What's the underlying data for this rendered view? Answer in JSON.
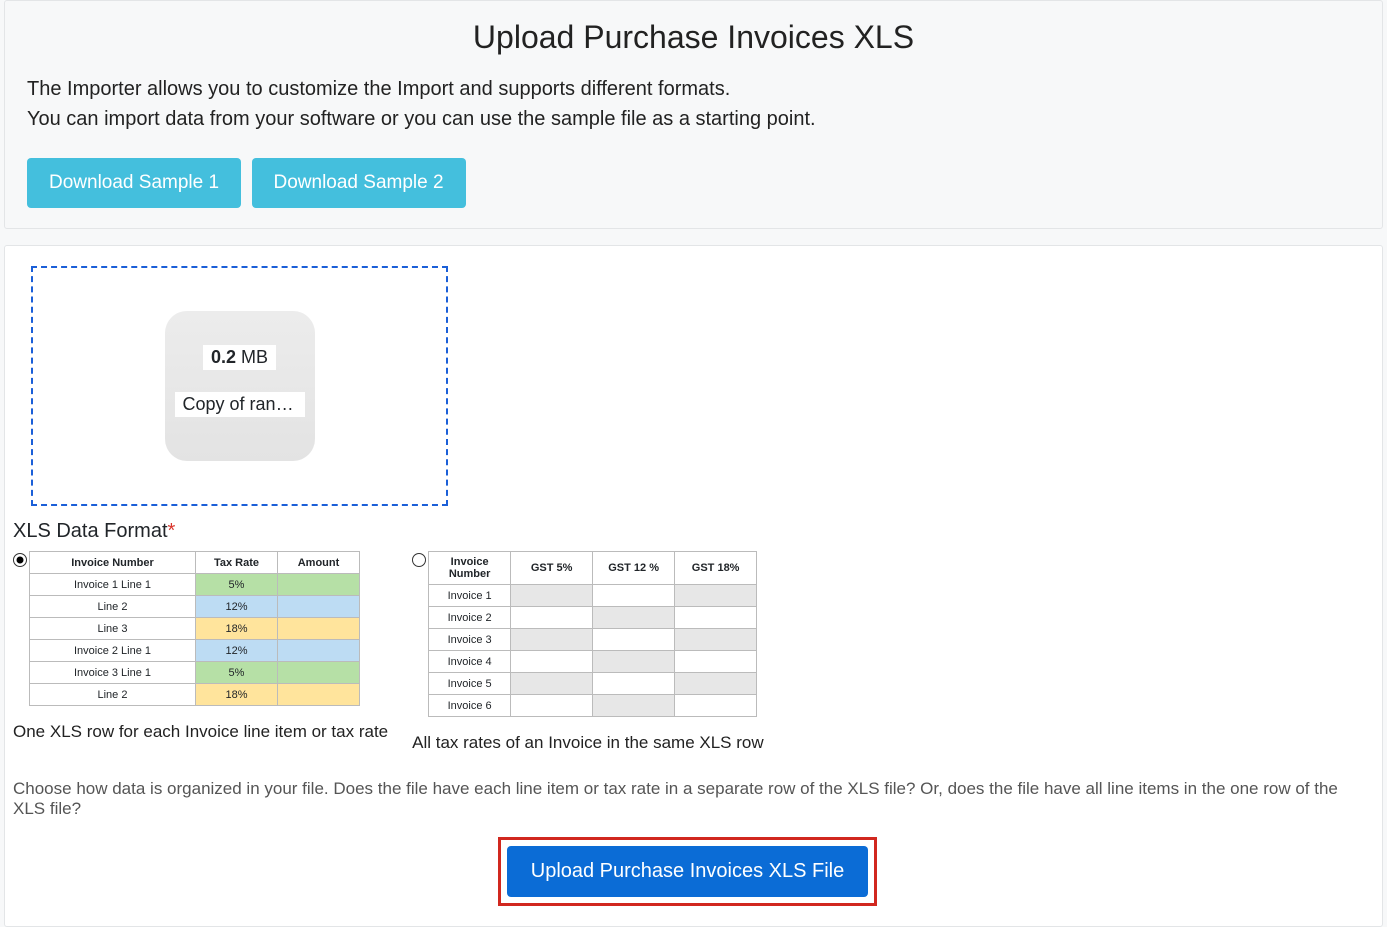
{
  "header": {
    "title": "Upload Purchase Invoices XLS",
    "intro_line1": "The Importer allows you to customize the Import and supports different formats.",
    "intro_line2": "You can import data from your software or you can use the sample file as a starting point.",
    "download_sample_1": "Download Sample 1",
    "download_sample_2": "Download Sample 2"
  },
  "dropzone": {
    "file_size_number": "0.2",
    "file_size_unit": "MB",
    "file_name": "Copy of rand..."
  },
  "format": {
    "label": "XLS Data Format",
    "required_marker": "*",
    "option1": {
      "selected": true,
      "caption": "One XLS row for each Invoice line item or tax rate",
      "headers": [
        "Invoice Number",
        "Tax Rate",
        "Amount"
      ],
      "rows": [
        {
          "c0": "Invoice 1 Line 1",
          "c1": "5%",
          "c2": "",
          "cls": "g"
        },
        {
          "c0": "Line 2",
          "c1": "12%",
          "c2": "",
          "cls": "b"
        },
        {
          "c0": "Line 3",
          "c1": "18%",
          "c2": "",
          "cls": "y"
        },
        {
          "c0": "Invoice 2 Line 1",
          "c1": "12%",
          "c2": "",
          "cls": "b"
        },
        {
          "c0": "Invoice 3 Line 1",
          "c1": "5%",
          "c2": "",
          "cls": "g"
        },
        {
          "c0": "Line 2",
          "c1": "18%",
          "c2": "",
          "cls": "y"
        }
      ]
    },
    "option2": {
      "selected": false,
      "caption": "All tax rates of an Invoice in the same XLS row",
      "headers": [
        "Invoice Number",
        "GST 5%",
        "GST 12 %",
        "GST 18%"
      ],
      "rows": [
        {
          "c0": "Invoice 1",
          "shade": [
            1,
            3
          ]
        },
        {
          "c0": "Invoice 2",
          "shade": [
            2
          ]
        },
        {
          "c0": "Invoice 3",
          "shade": [
            1,
            3
          ]
        },
        {
          "c0": "Invoice 4",
          "shade": [
            2
          ]
        },
        {
          "c0": "Invoice 5",
          "shade": [
            1,
            3
          ]
        },
        {
          "c0": "Invoice 6",
          "shade": [
            2
          ]
        }
      ]
    },
    "help": "Choose how data is organized in your file. Does the file have each line item or tax rate in a separate row of the XLS file? Or, does the file have all line items in the one row of the XLS file?"
  },
  "actions": {
    "upload_button": "Upload Purchase Invoices XLS File"
  }
}
